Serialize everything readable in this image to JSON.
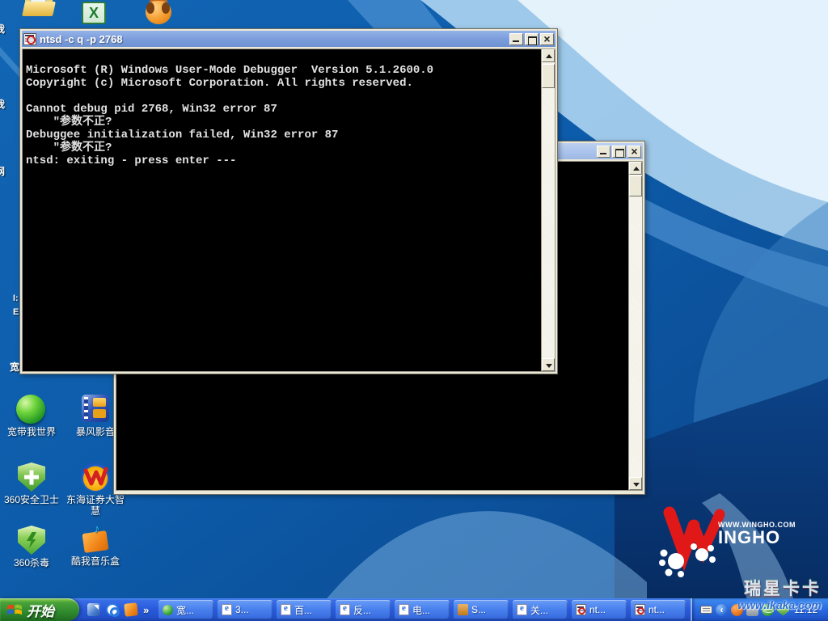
{
  "desktop": {
    "edge_fragments": [
      "我",
      "我",
      "网",
      "I:",
      "E:",
      "宽"
    ],
    "icons": [
      {
        "label": "宽带我世界"
      },
      {
        "label": "暴风影音"
      },
      {
        "label": "360安全卫士"
      },
      {
        "label": "东海证券大智慧"
      },
      {
        "label": "360杀毒"
      },
      {
        "label": "酷我音乐盒"
      }
    ],
    "wingho_url": "WWW.WINGHO.COM",
    "wingho_name": "INGHO",
    "kaka_title": "瑞星卡卡",
    "kaka_url": "www.ikaka.com"
  },
  "window1": {
    "title": "ntsd -c q -p 2768",
    "lines": [
      "Microsoft (R) Windows User-Mode Debugger  Version 5.1.2600.0",
      "Copyright (c) Microsoft Corporation. All rights reserved.",
      "",
      "Cannot debug pid 2768, Win32 error 87",
      "    \"参数不正?",
      "Debuggee initialization failed, Win32 error 87",
      "    \"参数不正?",
      "ntsd: exiting - press enter ---"
    ]
  },
  "taskbar": {
    "start_label": "开始",
    "more_chevron": "»",
    "tray_chevron": "‹",
    "buttons": [
      {
        "label": "宽..."
      },
      {
        "label": "3..."
      },
      {
        "label": "百..."
      },
      {
        "label": "反..."
      },
      {
        "label": "电..."
      },
      {
        "label": "S..."
      },
      {
        "label": "关..."
      },
      {
        "label": "nt..."
      },
      {
        "label": "nt..."
      }
    ],
    "clock": "11:12"
  }
}
